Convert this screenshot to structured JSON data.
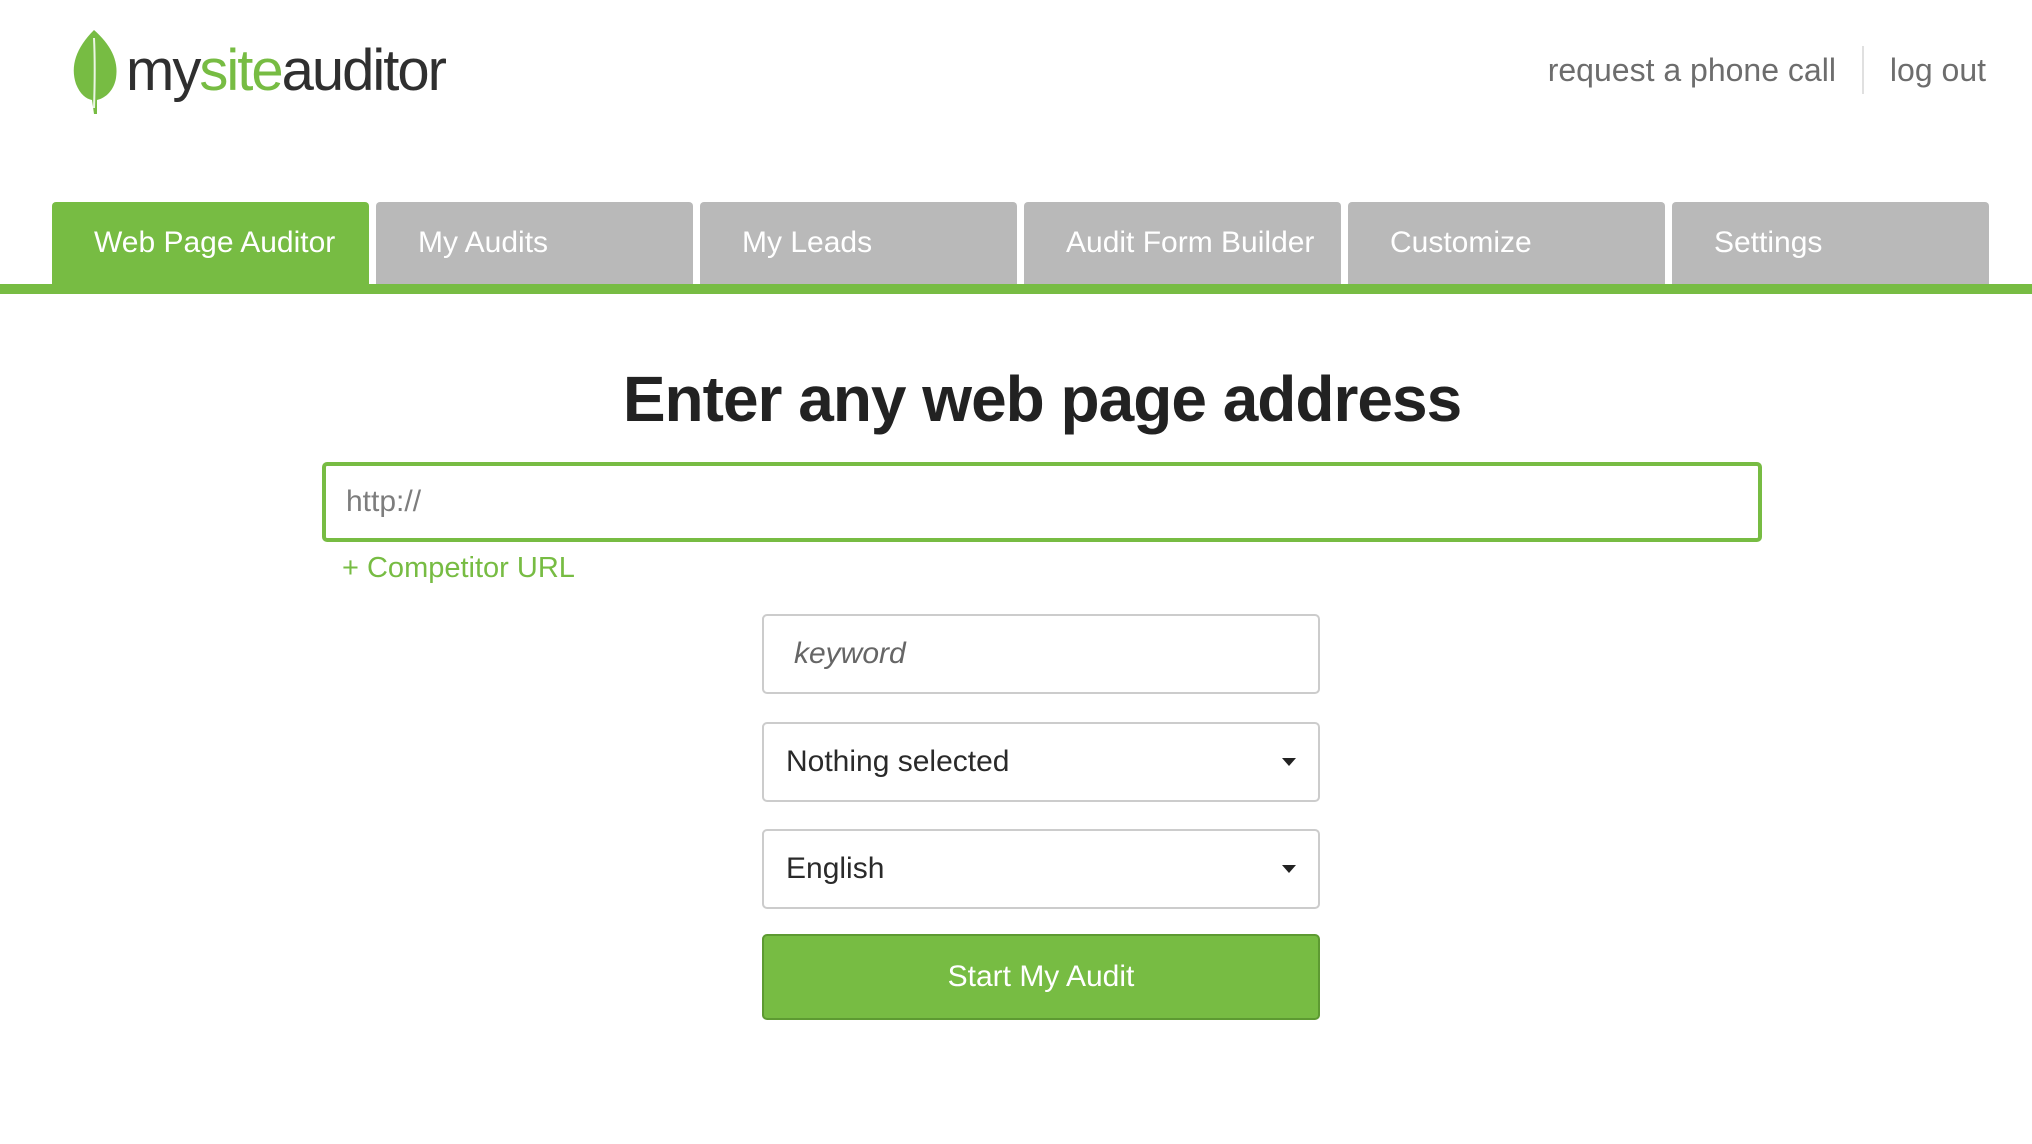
{
  "header": {
    "logo": {
      "part1": "my",
      "part2": "site",
      "part3": "auditor",
      "icon": "leaf-icon"
    },
    "links": {
      "phone": "request a phone call",
      "logout": "log out"
    }
  },
  "tabs": [
    {
      "label": "Web Page Auditor",
      "active": true
    },
    {
      "label": "My Audits",
      "active": false
    },
    {
      "label": "My Leads",
      "active": false
    },
    {
      "label": "Audit Form Builder",
      "active": false
    },
    {
      "label": "Customize",
      "active": false
    },
    {
      "label": "Settings",
      "active": false
    }
  ],
  "main": {
    "title": "Enter any web page address",
    "url_input": {
      "placeholder": "http://",
      "value": ""
    },
    "competitor_link": "+ Competitor URL",
    "keyword_input": {
      "placeholder": "keyword",
      "value": ""
    },
    "select_nothing": {
      "value": "Nothing selected"
    },
    "select_language": {
      "value": "English"
    },
    "start_button": "Start My Audit"
  },
  "colors": {
    "accent": "#77bc43",
    "tab_inactive": "#b9b9b9",
    "text_dark": "#222222",
    "text_muted": "#6d6d6d"
  }
}
